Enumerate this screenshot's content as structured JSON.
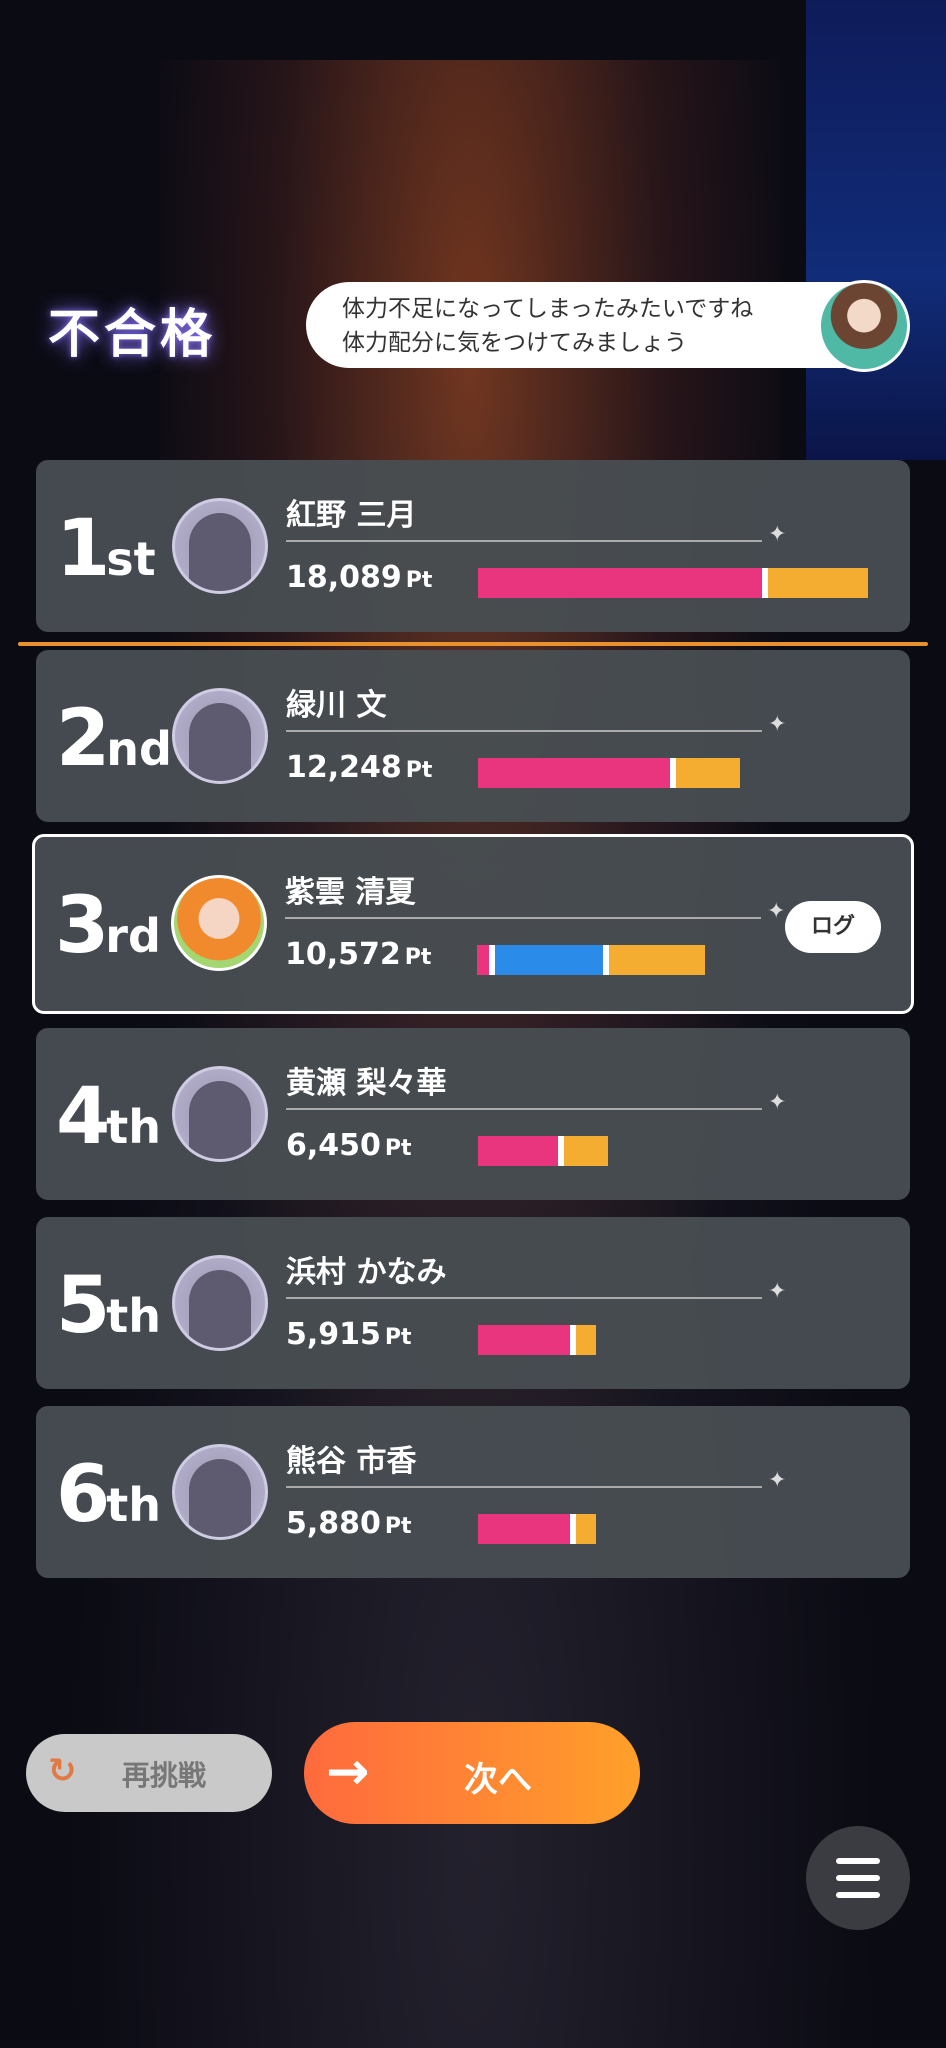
{
  "header": {
    "result": "不合格",
    "message_line1": "体力不足になってしまったみたいですね",
    "message_line2": "体力配分に気をつけてみましょう"
  },
  "rankings": [
    {
      "rank_num": "1",
      "rank_suffix": "st",
      "name": "紅野 三月",
      "points": "18,089",
      "unit": "Pt",
      "bars": {
        "pink": 0.71,
        "blue": 0,
        "yellow": 0.25
      }
    },
    {
      "rank_num": "2",
      "rank_suffix": "nd",
      "name": "緑川 文",
      "points": "12,248",
      "unit": "Pt",
      "bars": {
        "pink": 0.48,
        "blue": 0,
        "yellow": 0.16
      }
    },
    {
      "rank_num": "3",
      "rank_suffix": "rd",
      "name": "紫雲 清夏",
      "points": "10,572",
      "unit": "Pt",
      "bars": {
        "pink": 0.03,
        "blue": 0.27,
        "yellow": 0.24
      },
      "is_player": true,
      "log_label": "ログ"
    },
    {
      "rank_num": "4",
      "rank_suffix": "th",
      "name": "黄瀬 梨々華",
      "points": "6,450",
      "unit": "Pt",
      "bars": {
        "pink": 0.2,
        "blue": 0,
        "yellow": 0.11
      }
    },
    {
      "rank_num": "5",
      "rank_suffix": "th",
      "name": "浜村 かなみ",
      "points": "5,915",
      "unit": "Pt",
      "bars": {
        "pink": 0.23,
        "blue": 0,
        "yellow": 0.05
      }
    },
    {
      "rank_num": "6",
      "rank_suffix": "th",
      "name": "熊谷 市香",
      "points": "5,880",
      "unit": "Pt",
      "bars": {
        "pink": 0.23,
        "blue": 0,
        "yellow": 0.05
      }
    }
  ],
  "buttons": {
    "retry": "再挑戦",
    "next": "次へ"
  },
  "colors": {
    "pink": "#e8357d",
    "blue": "#2b8be8",
    "yellow": "#f4ad30",
    "accent": "#ff7a35"
  }
}
